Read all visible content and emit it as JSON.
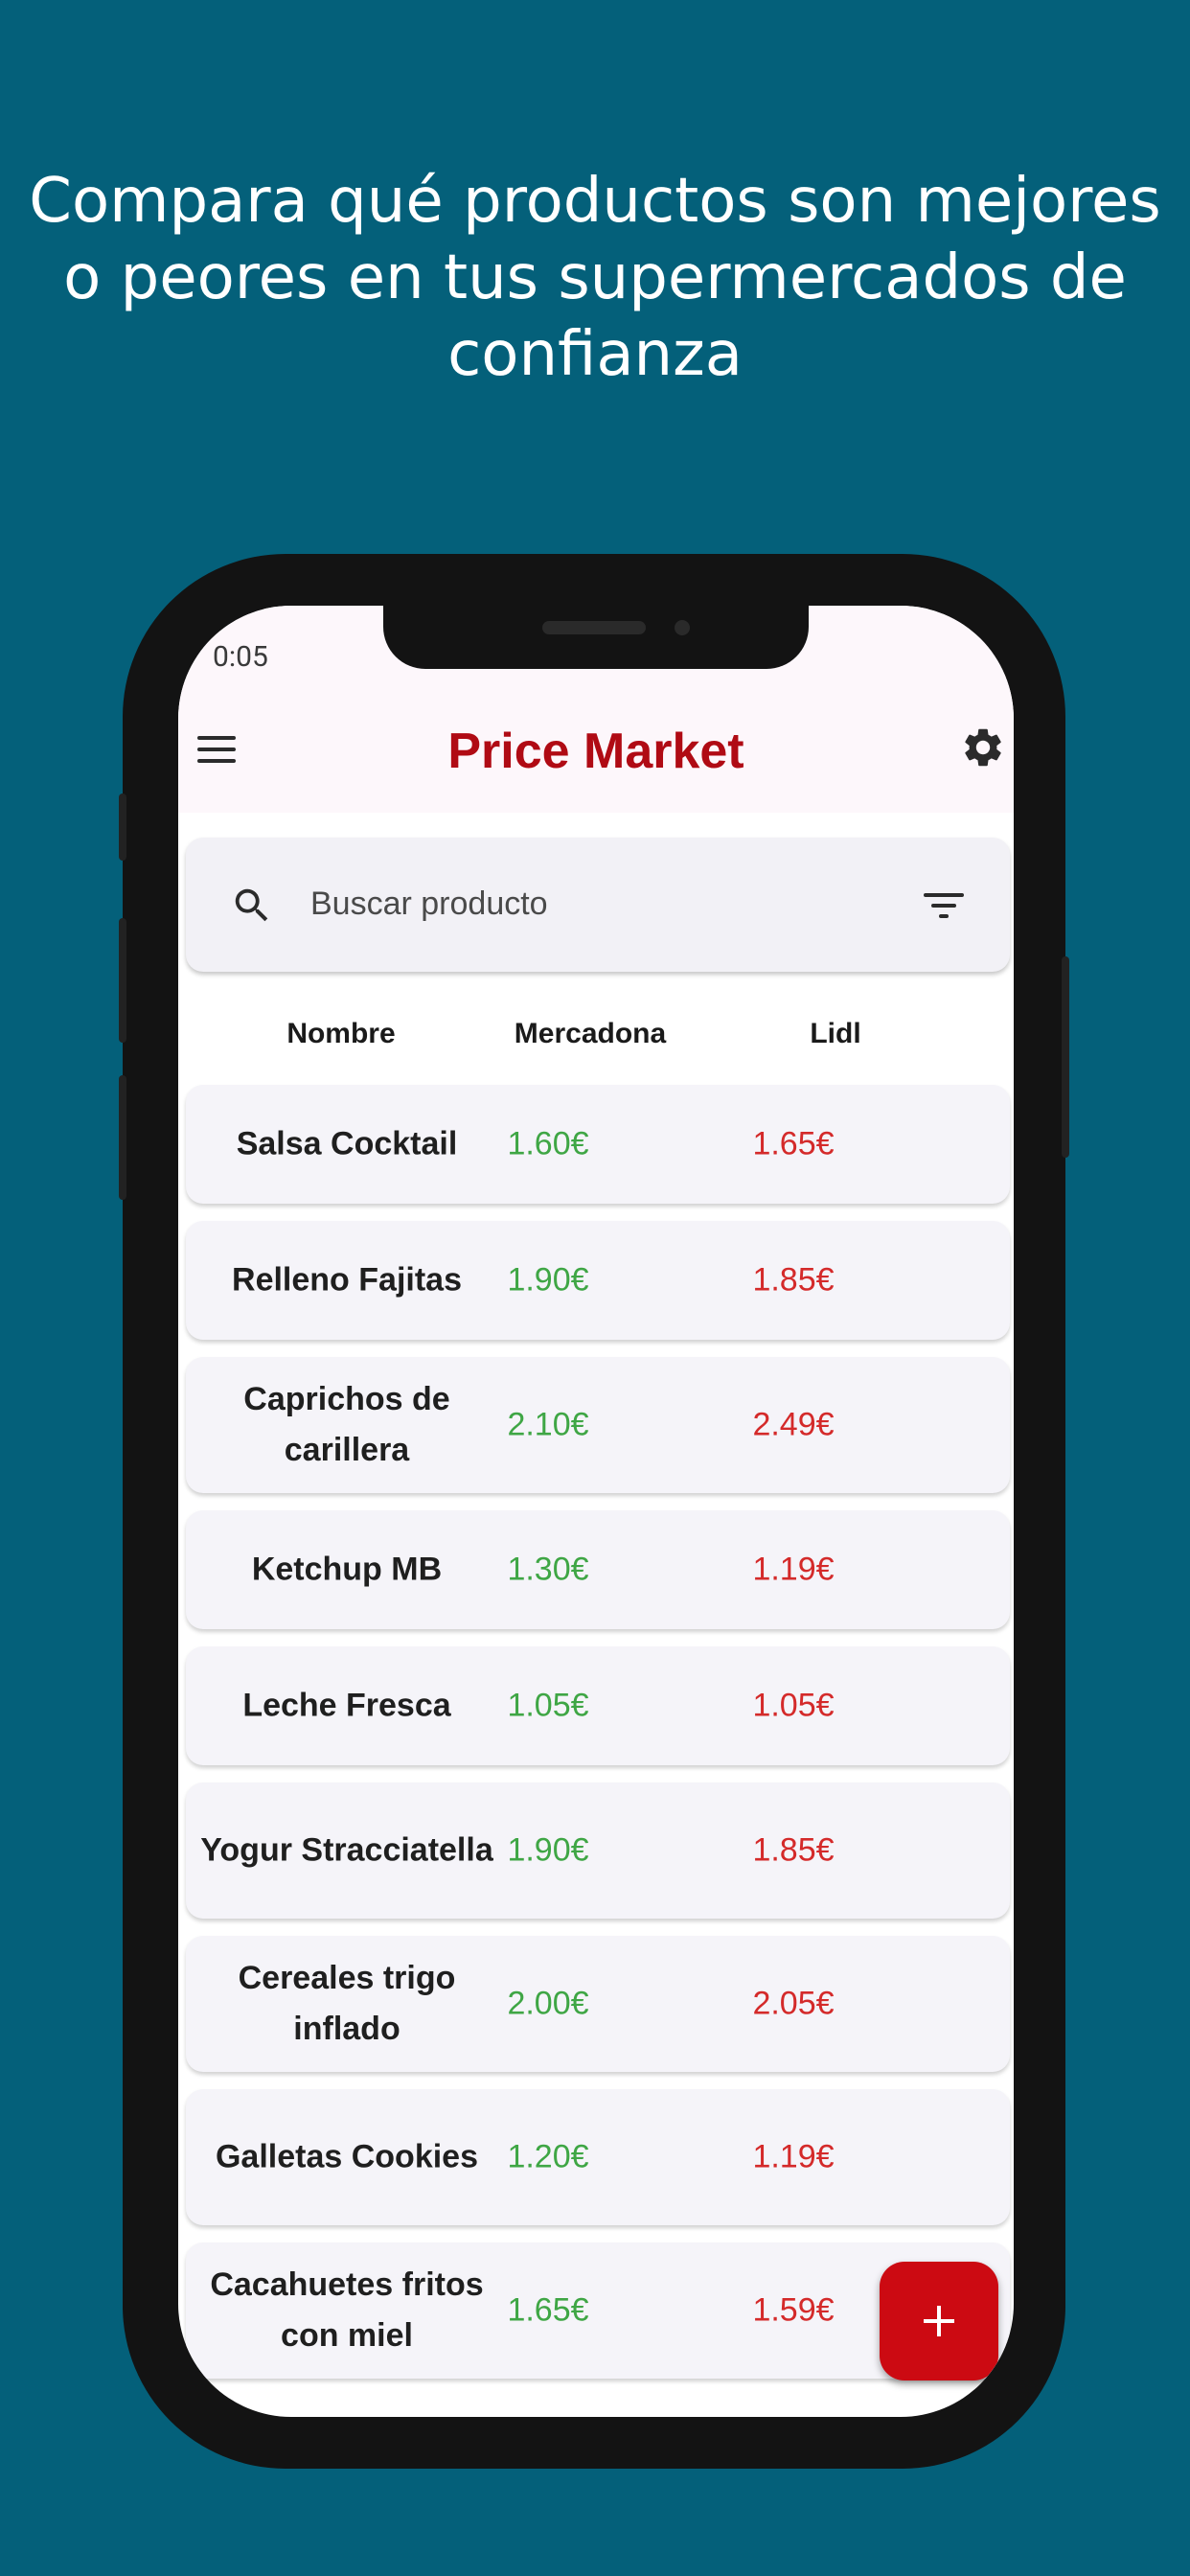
{
  "headline": "Compara qué productos son mejores o peores en tus supermercados de confianza",
  "status_bar": {
    "time": "0:05"
  },
  "appbar": {
    "title": "Price Market",
    "menu_icon": "menu-icon",
    "settings_icon": "gear-icon"
  },
  "search": {
    "placeholder": "Buscar producto",
    "search_icon": "search-icon",
    "filter_icon": "filter-icon"
  },
  "table": {
    "headers": [
      "Nombre",
      "Mercadona",
      "Lidl"
    ],
    "rows": [
      {
        "name": "Salsa Cocktail",
        "mercadona": "1.60€",
        "lidl": "1.65€"
      },
      {
        "name": "Relleno Fajitas",
        "mercadona": "1.90€",
        "lidl": "1.85€"
      },
      {
        "name": "Caprichos de carillera",
        "mercadona": "2.10€",
        "lidl": "2.49€"
      },
      {
        "name": "Ketchup MB",
        "mercadona": "1.30€",
        "lidl": "1.19€"
      },
      {
        "name": "Leche Fresca",
        "mercadona": "1.05€",
        "lidl": "1.05€"
      },
      {
        "name": "Yogur Stracciatella",
        "mercadona": "1.90€",
        "lidl": "1.85€"
      },
      {
        "name": "Cereales trigo inflado",
        "mercadona": "2.00€",
        "lidl": "2.05€"
      },
      {
        "name": "Galletas Cookies",
        "mercadona": "1.20€",
        "lidl": "1.19€"
      },
      {
        "name": "Cacahuetes fritos con miel",
        "mercadona": "1.65€",
        "lidl": "1.59€"
      }
    ]
  },
  "fab": {
    "icon": "plus-icon"
  },
  "colors": {
    "background": "#04607a",
    "title_red": "#b00b14",
    "mercadona_price": "#3fa645",
    "lidl_price": "#d42a2a",
    "fab": "#cc0a12"
  }
}
